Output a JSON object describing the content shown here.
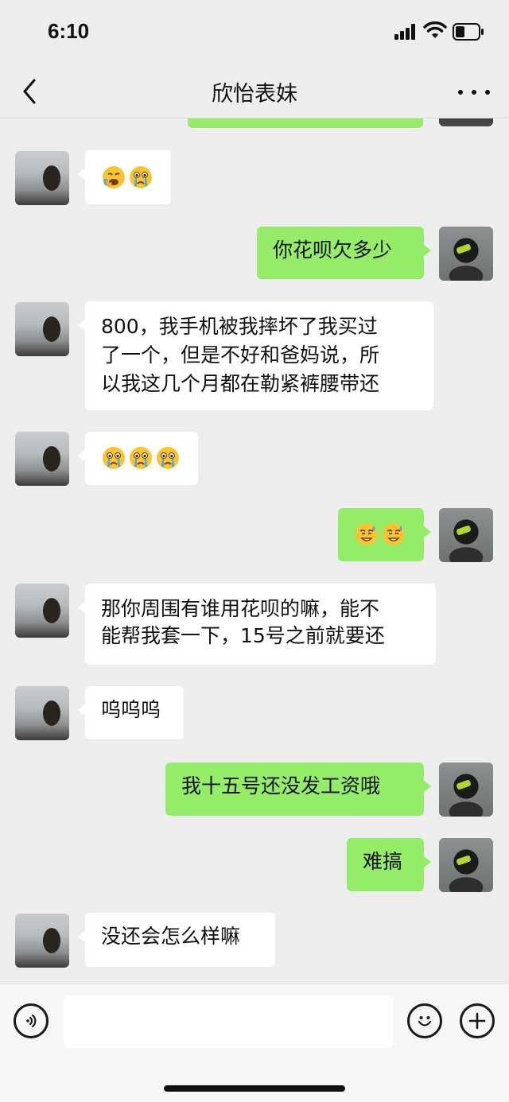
{
  "status_bar": {
    "time": "6:10"
  },
  "nav": {
    "title": "欣怡表妹",
    "back_icon": "chevron-left-icon",
    "more_icon": "more-dots-icon"
  },
  "theme": {
    "self_bubble": "#95ec69",
    "other_bubble": "#ffffff",
    "background": "#ededed"
  },
  "messages": [
    {
      "sender": "other",
      "type": "emoji",
      "emojis": [
        "face-with-hand-over-mouth-crying",
        "crying-face"
      ]
    },
    {
      "sender": "self",
      "type": "text",
      "text": "你花呗欠多少"
    },
    {
      "sender": "other",
      "type": "text",
      "lines": [
        "800，我手机被我摔坏了我买过",
        "了一个，但是不好和爸妈说，所",
        "以我这几个月都在勒紧裤腰带还"
      ]
    },
    {
      "sender": "other",
      "type": "emoji",
      "emojis": [
        "crying-face",
        "crying-face",
        "crying-face"
      ]
    },
    {
      "sender": "self",
      "type": "emoji",
      "emojis": [
        "sweat-smile-face",
        "sweat-smile-face"
      ]
    },
    {
      "sender": "other",
      "type": "text",
      "lines": [
        "那你周围有谁用花呗的嘛，能不",
        "能帮我套一下，15号之前就要还"
      ]
    },
    {
      "sender": "other",
      "type": "text",
      "text": "呜呜呜"
    },
    {
      "sender": "self",
      "type": "text",
      "text": "我十五号还没发工资哦"
    },
    {
      "sender": "self",
      "type": "text",
      "text": "难搞"
    },
    {
      "sender": "other",
      "type": "text",
      "text": "没还会怎么样嘛"
    }
  ],
  "input_bar": {
    "voice_icon": "voice-icon",
    "emoji_icon": "smiley-icon",
    "plus_icon": "plus-icon",
    "input_value": ""
  }
}
